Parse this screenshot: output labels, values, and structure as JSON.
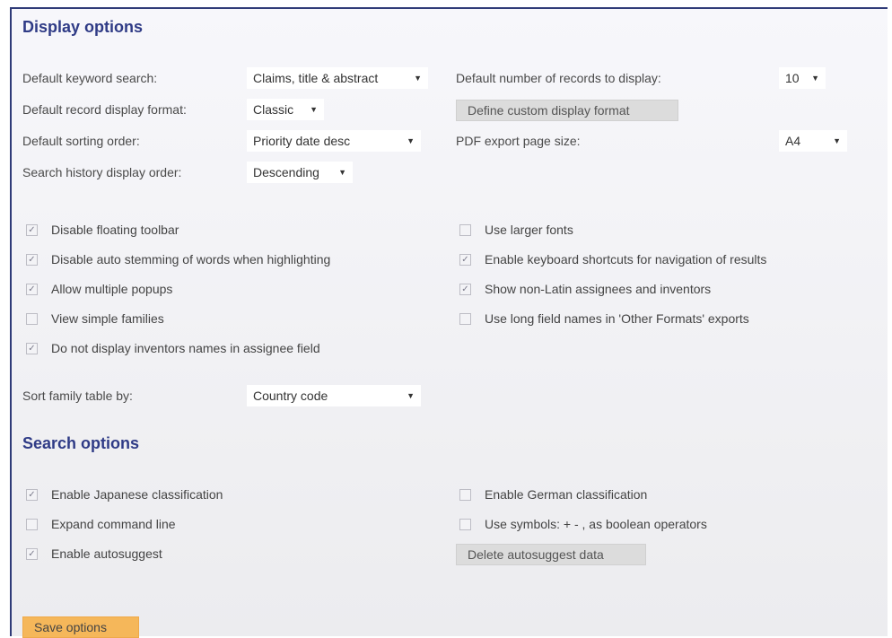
{
  "display": {
    "heading": "Display options",
    "keyword_search": {
      "label": "Default keyword search:",
      "value": "Claims, title & abstract"
    },
    "record_format": {
      "label": "Default record display format:",
      "value": "Classic"
    },
    "sorting_order": {
      "label": "Default sorting order:",
      "value": "Priority date desc"
    },
    "history_order": {
      "label": "Search history display order:",
      "value": "Descending"
    },
    "num_records": {
      "label": "Default number of records to display:",
      "value": "10"
    },
    "custom_format_button": "Define custom display format",
    "pdf_size": {
      "label": "PDF export page size:",
      "value": "A4"
    },
    "checkboxes_left": [
      {
        "label": "Disable floating toolbar",
        "checked": true
      },
      {
        "label": "Disable auto stemming of words when highlighting",
        "checked": true
      },
      {
        "label": "Allow multiple popups",
        "checked": true
      },
      {
        "label": "View simple families",
        "checked": false
      },
      {
        "label": "Do not display inventors names in assignee field",
        "checked": true
      }
    ],
    "checkboxes_right": [
      {
        "label": "Use larger fonts",
        "checked": false
      },
      {
        "label": "Enable keyboard shortcuts for navigation of results",
        "checked": true
      },
      {
        "label": "Show non-Latin assignees and inventors",
        "checked": true
      },
      {
        "label": "Use long field names in 'Other Formats' exports",
        "checked": false
      }
    ],
    "family_sort": {
      "label": "Sort family table by:",
      "value": "Country code"
    }
  },
  "search": {
    "heading": "Search options",
    "checkboxes_left": [
      {
        "label": "Enable Japanese classification",
        "checked": true
      },
      {
        "label": "Expand command line",
        "checked": false
      },
      {
        "label": "Enable autosuggest",
        "checked": true
      }
    ],
    "checkboxes_right": [
      {
        "label": "Enable German classification",
        "checked": false
      },
      {
        "label": "Use symbols: + - , as boolean operators",
        "checked": false
      }
    ],
    "delete_autosuggest_button": "Delete autosuggest data"
  },
  "save_button": "Save options",
  "colors": {
    "heading": "#2f3b86",
    "border": "#2f3b78",
    "save": "#f5b75a"
  }
}
